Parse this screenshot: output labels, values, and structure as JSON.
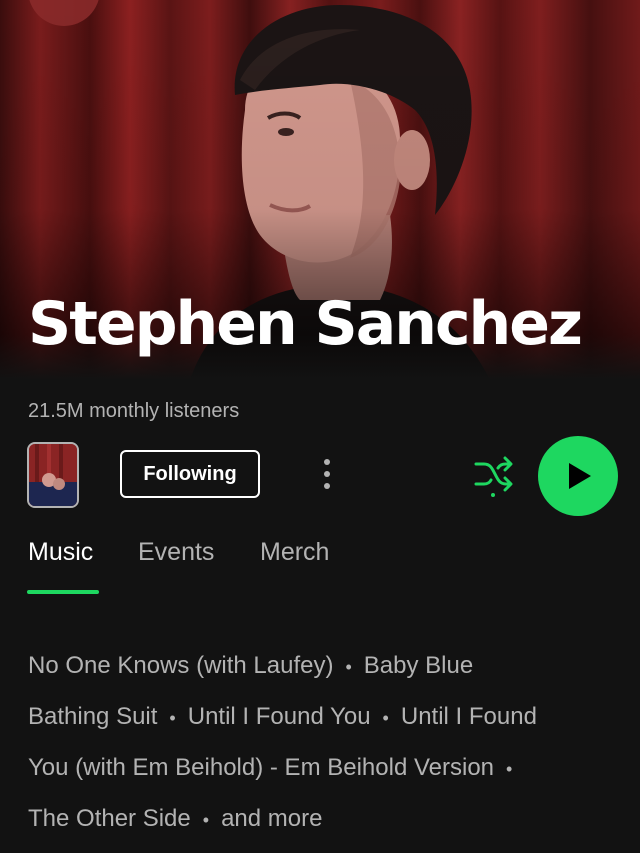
{
  "artist": {
    "name": "Stephen Sanchez",
    "monthly_listeners": "21.5M monthly listeners"
  },
  "actions": {
    "follow_label": "Following",
    "more_icon": "more-vertical-icon",
    "shuffle_icon": "shuffle-icon",
    "play_icon": "play-icon"
  },
  "tabs": [
    {
      "label": "Music",
      "active": true
    },
    {
      "label": "Events",
      "active": false
    },
    {
      "label": "Merch",
      "active": false
    }
  ],
  "popular_songs": {
    "line1": [
      "No One Knows (with Laufey)",
      "Baby Blue"
    ],
    "line2": [
      "Bathing Suit",
      "Until I Found You",
      "Until I Found"
    ],
    "line3": [
      "You (with Em Beihold) - Em Beihold Version"
    ],
    "line4": [
      "The Other Side",
      "and more"
    ],
    "separator": "•"
  },
  "colors": {
    "accent": "#1ed760",
    "background": "#121212",
    "secondary_text": "#b3b3b3"
  }
}
